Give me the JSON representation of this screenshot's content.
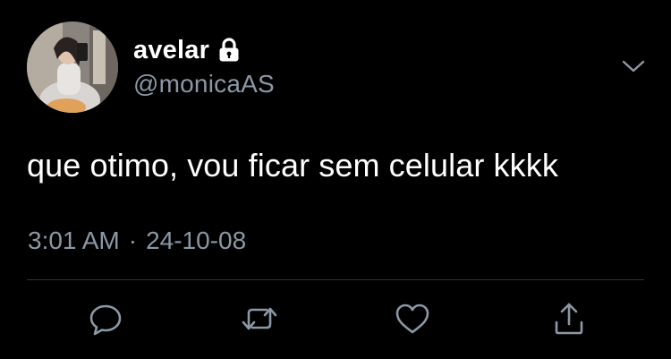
{
  "user": {
    "display_name": "avelar",
    "handle": "@monicaAS",
    "protected_icon": "lock-icon"
  },
  "tweet": {
    "text": "que otimo, vou ficar sem celular kkkk",
    "time": "3:01 AM",
    "separator": "·",
    "date": "24-10-08"
  },
  "actions": [
    {
      "name": "reply",
      "icon": "reply-icon"
    },
    {
      "name": "retweet",
      "icon": "retweet-icon"
    },
    {
      "name": "like",
      "icon": "heart-icon"
    },
    {
      "name": "share",
      "icon": "share-icon"
    }
  ],
  "menu": {
    "icon": "chevron-down-icon"
  },
  "colors": {
    "background": "#000000",
    "primary_text": "#ffffff",
    "secondary_text": "#8b98a5",
    "divider": "#2f3336"
  }
}
